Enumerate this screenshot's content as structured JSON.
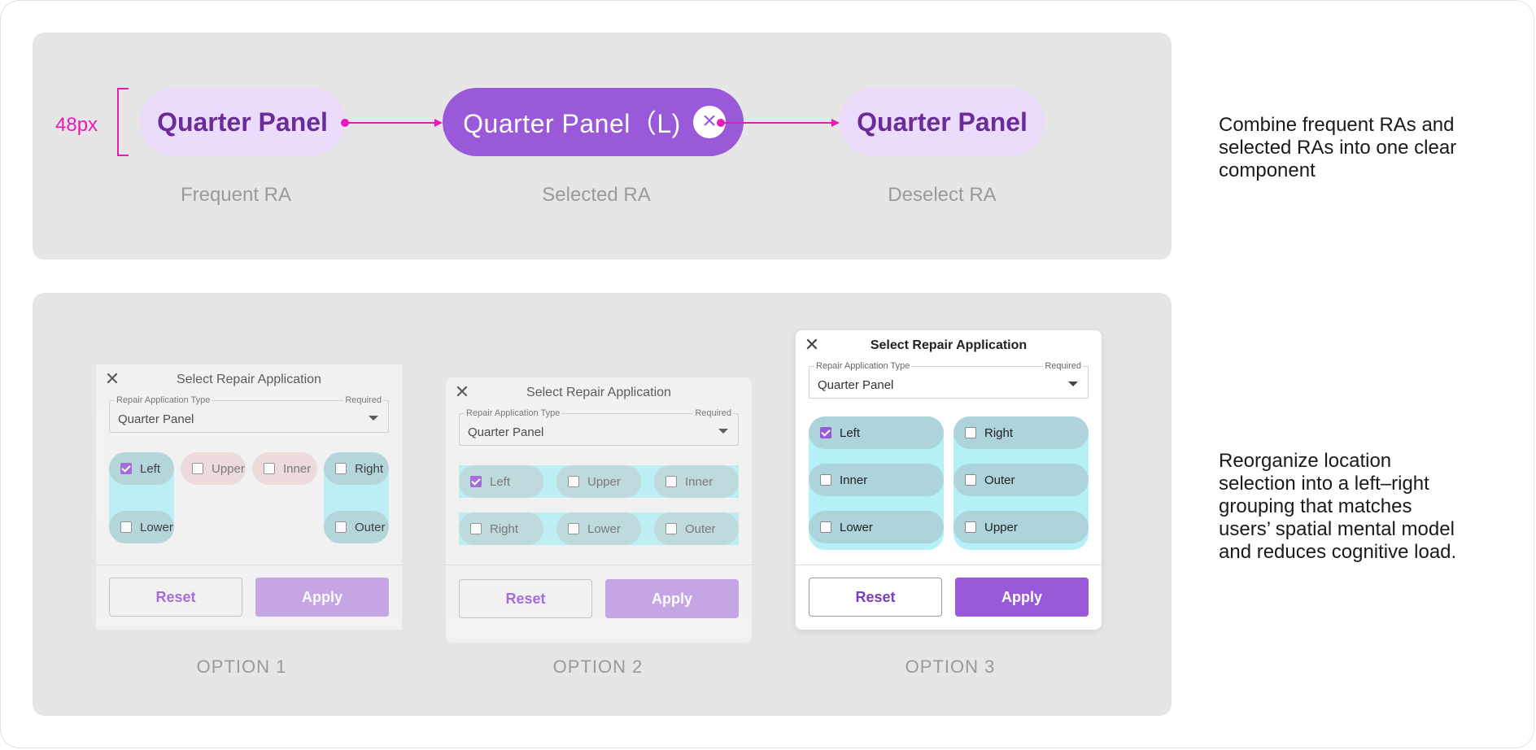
{
  "top": {
    "measure_label": "48px",
    "chip_frequent": "Quarter Panel",
    "chip_selected": "Quarter Panel（L)",
    "chip_close": "×",
    "chip_deselect": "Quarter Panel",
    "cap_frequent": "Frequent RA",
    "cap_selected": "Selected RA",
    "cap_deselect": "Deselect RA"
  },
  "notes": {
    "top": [
      "Combine frequent RAs and",
      "selected RAs into one clear",
      "component"
    ],
    "bottom": [
      "Reorganize location",
      "selection into a left–right",
      "grouping that matches",
      "users’ spatial mental model",
      "and reduces cognitive load."
    ]
  },
  "dialog": {
    "title": "Select Repair Application",
    "field_label": "Repair Application Type",
    "field_required": "Required",
    "field_value": "Quarter Panel",
    "reset": "Reset",
    "apply": "Apply",
    "close": "✕"
  },
  "options": {
    "o1": {
      "caption": "OPTION 1",
      "items": [
        "Left",
        "Upper",
        "Inner",
        "Right",
        "Lower",
        "Outer"
      ]
    },
    "o2": {
      "caption": "OPTION 2",
      "items": [
        "Left",
        "Upper",
        "Inner",
        "Right",
        "Lower",
        "Outer"
      ]
    },
    "o3": {
      "caption": "OPTION 3",
      "items": [
        "Left",
        "Right",
        "Inner",
        "Outer",
        "Lower",
        "Upper"
      ]
    }
  },
  "colors": {
    "accent": "#9a59d8",
    "accent_light": "#ecdcfb",
    "measure": "#e81bb8",
    "highlight": "#b5f0f6"
  }
}
